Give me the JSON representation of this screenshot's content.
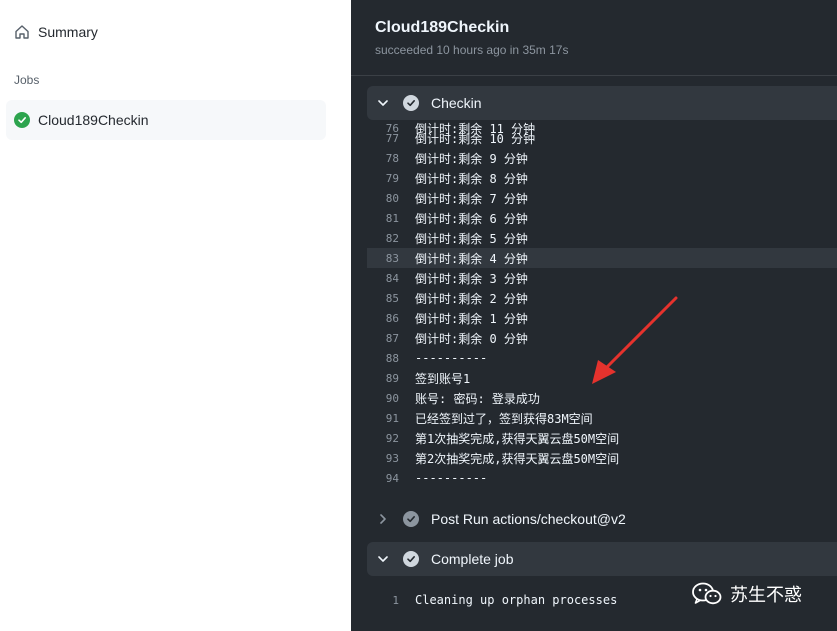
{
  "sidebar": {
    "summary_label": "Summary",
    "jobs_heading": "Jobs",
    "job_label": "Cloud189Checkin"
  },
  "run": {
    "title": "Cloud189Checkin",
    "subtitle": "succeeded 10 hours ago in 35m 17s"
  },
  "steps": [
    {
      "label": "Checkin",
      "expanded": true,
      "status": "success"
    },
    {
      "label": "Post Run actions/checkout@v2",
      "expanded": false,
      "status": "success"
    },
    {
      "label": "Complete job",
      "expanded": true,
      "status": "success"
    }
  ],
  "log": [
    {
      "n": "76",
      "text": "倒计时:剩余 11 分钟"
    },
    {
      "n": "77",
      "text": "倒计时:剩余 10 分钟"
    },
    {
      "n": "78",
      "text": "倒计时:剩余 9 分钟"
    },
    {
      "n": "79",
      "text": "倒计时:剩余 8 分钟"
    },
    {
      "n": "80",
      "text": "倒计时:剩余 7 分钟"
    },
    {
      "n": "81",
      "text": "倒计时:剩余 6 分钟"
    },
    {
      "n": "82",
      "text": "倒计时:剩余 5 分钟"
    },
    {
      "n": "83",
      "text": "倒计时:剩余 4 分钟",
      "highlight": true
    },
    {
      "n": "84",
      "text": "倒计时:剩余 3 分钟"
    },
    {
      "n": "85",
      "text": "倒计时:剩余 2 分钟"
    },
    {
      "n": "86",
      "text": "倒计时:剩余 1 分钟"
    },
    {
      "n": "87",
      "text": "倒计时:剩余 0 分钟"
    },
    {
      "n": "88",
      "text": "----------"
    },
    {
      "n": "89",
      "text": "签到账号1"
    },
    {
      "n": "90",
      "text": "账号: 密码: 登录成功"
    },
    {
      "n": "91",
      "text": "已经签到过了，签到获得83M空间"
    },
    {
      "n": "92",
      "text": "第1次抽奖完成,获得天翼云盘50M空间"
    },
    {
      "n": "93",
      "text": "第2次抽奖完成,获得天翼云盘50M空间"
    },
    {
      "n": "94",
      "text": "----------"
    }
  ],
  "complete_log": [
    {
      "n": "1",
      "text": "Cleaning up orphan processes"
    }
  ],
  "watermark": {
    "text": "苏生不惑",
    "icon": "wechat-icon"
  },
  "colors": {
    "success": "#2da44e",
    "panel": "#24292f",
    "arrow": "#e5322d"
  }
}
